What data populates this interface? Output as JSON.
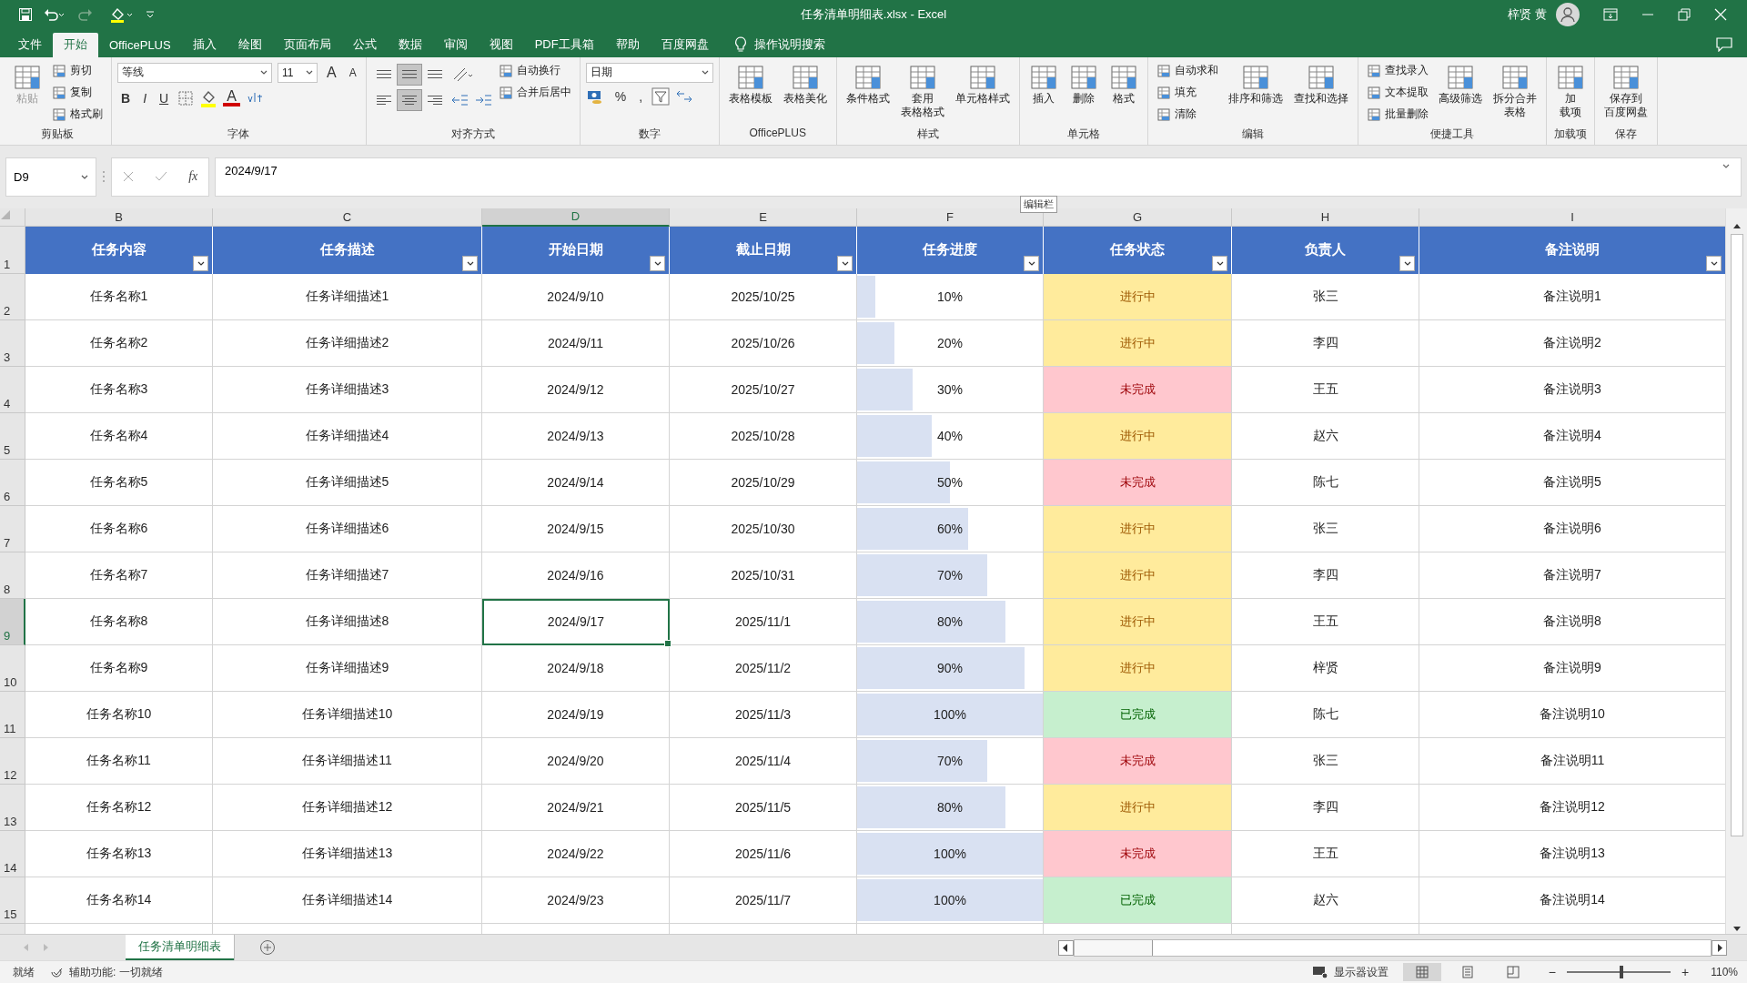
{
  "window": {
    "title": "任务清单明细表.xlsx  -  Excel",
    "user": "梓贤 黄"
  },
  "tabs": [
    {
      "label": "文件",
      "selected": false
    },
    {
      "label": "开始",
      "selected": true
    },
    {
      "label": "OfficePLUS",
      "selected": false
    },
    {
      "label": "插入",
      "selected": false
    },
    {
      "label": "绘图",
      "selected": false
    },
    {
      "label": "页面布局",
      "selected": false
    },
    {
      "label": "公式",
      "selected": false
    },
    {
      "label": "数据",
      "selected": false
    },
    {
      "label": "审阅",
      "selected": false
    },
    {
      "label": "视图",
      "selected": false
    },
    {
      "label": "PDF工具箱",
      "selected": false
    },
    {
      "label": "帮助",
      "selected": false
    },
    {
      "label": "百度网盘",
      "selected": false
    }
  ],
  "tell_me": "操作说明搜索",
  "ribbon": {
    "groups": [
      {
        "kind": "buttons",
        "label": "剪贴板",
        "items": [
          {
            "kind": "large",
            "label": "粘贴",
            "disabled": true
          },
          {
            "kind": "small",
            "label": "剪切",
            "disabled": false
          },
          {
            "kind": "small",
            "label": "复制",
            "disabled": false
          },
          {
            "kind": "small",
            "label": "格式刷",
            "disabled": false
          }
        ]
      },
      {
        "kind": "font",
        "label": "字体",
        "font": "等线",
        "size": "11",
        "size_buttons": [
          "A",
          "A"
        ],
        "styles": [
          "B",
          "I",
          "U"
        ],
        "color_letter": "A"
      },
      {
        "kind": "align",
        "label": "对齐方式",
        "align_buttons": [
          {
            "selected": false
          },
          {
            "selected": true
          },
          {
            "selected": false
          },
          {
            "selected": false
          },
          {
            "selected": true
          },
          {
            "selected": false
          }
        ],
        "items": [
          {
            "kind": "small",
            "label": "自动换行",
            "disabled": false
          },
          {
            "kind": "small",
            "label": "合并后居中",
            "disabled": false
          }
        ]
      },
      {
        "kind": "number",
        "label": "数字",
        "format": "日期",
        "symbols": [
          "%",
          ","
        ]
      },
      {
        "kind": "buttons",
        "label": "OfficePLUS",
        "items": [
          {
            "kind": "large",
            "label": "表格模板",
            "disabled": false
          },
          {
            "kind": "large",
            "label": "表格美化",
            "disabled": false
          }
        ]
      },
      {
        "kind": "buttons",
        "label": "样式",
        "items": [
          {
            "kind": "large",
            "label": "条件格式",
            "disabled": false
          },
          {
            "kind": "large",
            "label": "套用",
            "label_2": "表格格式",
            "disabled": false
          },
          {
            "kind": "large",
            "label": "单元格样式",
            "disabled": false
          }
        ]
      },
      {
        "kind": "buttons",
        "label": "单元格",
        "items": [
          {
            "kind": "large",
            "label": "插入",
            "disabled": false
          },
          {
            "kind": "large",
            "label": "删除",
            "disabled": false
          },
          {
            "kind": "large",
            "label": "格式",
            "disabled": false
          }
        ]
      },
      {
        "kind": "buttons",
        "label": "编辑",
        "items": [
          {
            "kind": "small",
            "label": "自动求和",
            "disabled": false
          },
          {
            "kind": "small",
            "label": "填充",
            "disabled": false
          },
          {
            "kind": "small",
            "label": "清除",
            "disabled": false
          },
          {
            "kind": "large",
            "label": "排序和筛选",
            "disabled": false
          },
          {
            "kind": "large",
            "label": "查找和选择",
            "disabled": false
          }
        ]
      },
      {
        "kind": "buttons",
        "label": "便捷工具",
        "items": [
          {
            "kind": "small",
            "label": "查找录入",
            "disabled": false
          },
          {
            "kind": "small",
            "label": "文本提取",
            "disabled": false
          },
          {
            "kind": "small",
            "label": "批量删除",
            "disabled": false
          },
          {
            "kind": "large",
            "label": "高级筛选",
            "disabled": false
          },
          {
            "kind": "large",
            "label": "拆分合并",
            "label_2": "表格",
            "disabled": false
          }
        ]
      },
      {
        "kind": "buttons",
        "label": "加载项",
        "items": [
          {
            "kind": "large",
            "label": "加",
            "label_2": "载项",
            "disabled": false
          }
        ]
      },
      {
        "kind": "buttons",
        "label": "保存",
        "items": [
          {
            "kind": "large",
            "label": "保存到",
            "label_2": "百度网盘",
            "disabled": false
          }
        ]
      }
    ]
  },
  "formula_bar": {
    "name_box": "D9",
    "fx": "fx",
    "value": "2024/9/17",
    "tooltip": "编辑栏"
  },
  "sheet": {
    "columns": [
      {
        "label": "B",
        "selected": false
      },
      {
        "label": "C",
        "selected": false
      },
      {
        "label": "D",
        "selected": true
      },
      {
        "label": "E",
        "selected": false
      },
      {
        "label": "F",
        "selected": false
      },
      {
        "label": "G",
        "selected": false
      },
      {
        "label": "H",
        "selected": false
      },
      {
        "label": "I",
        "selected": false
      }
    ],
    "header_row_number": "1",
    "headers": [
      "任务内容",
      "任务描述",
      "开始日期",
      "截止日期",
      "任务进度",
      "任务状态",
      "负责人",
      "备注说明"
    ],
    "rows": [
      {
        "number": "2",
        "row_selected": false,
        "name": "任务名称1",
        "desc": "任务详细描述1",
        "start": "2024/9/10",
        "start_selected": false,
        "end": "2025/10/25",
        "progress": "10%",
        "level": 0.1,
        "status": {
          "text": "进行中",
          "kind": "ongoing"
        },
        "owner": "张三",
        "note": "备注说明1"
      },
      {
        "number": "3",
        "row_selected": false,
        "name": "任务名称2",
        "desc": "任务详细描述2",
        "start": "2024/9/11",
        "start_selected": false,
        "end": "2025/10/26",
        "progress": "20%",
        "level": 0.2,
        "status": {
          "text": "进行中",
          "kind": "ongoing"
        },
        "owner": "李四",
        "note": "备注说明2"
      },
      {
        "number": "4",
        "row_selected": false,
        "name": "任务名称3",
        "desc": "任务详细描述3",
        "start": "2024/9/12",
        "start_selected": false,
        "end": "2025/10/27",
        "progress": "30%",
        "level": 0.3,
        "status": {
          "text": "未完成",
          "kind": "incomplete"
        },
        "owner": "王五",
        "note": "备注说明3"
      },
      {
        "number": "5",
        "row_selected": false,
        "name": "任务名称4",
        "desc": "任务详细描述4",
        "start": "2024/9/13",
        "start_selected": false,
        "end": "2025/10/28",
        "progress": "40%",
        "level": 0.4,
        "status": {
          "text": "进行中",
          "kind": "ongoing"
        },
        "owner": "赵六",
        "note": "备注说明4"
      },
      {
        "number": "6",
        "row_selected": false,
        "name": "任务名称5",
        "desc": "任务详细描述5",
        "start": "2024/9/14",
        "start_selected": false,
        "end": "2025/10/29",
        "progress": "50%",
        "level": 0.5,
        "status": {
          "text": "未完成",
          "kind": "incomplete"
        },
        "owner": "陈七",
        "note": "备注说明5"
      },
      {
        "number": "7",
        "row_selected": false,
        "name": "任务名称6",
        "desc": "任务详细描述6",
        "start": "2024/9/15",
        "start_selected": false,
        "end": "2025/10/30",
        "progress": "60%",
        "level": 0.6,
        "status": {
          "text": "进行中",
          "kind": "ongoing"
        },
        "owner": "张三",
        "note": "备注说明6"
      },
      {
        "number": "8",
        "row_selected": false,
        "name": "任务名称7",
        "desc": "任务详细描述7",
        "start": "2024/9/16",
        "start_selected": false,
        "end": "2025/10/31",
        "progress": "70%",
        "level": 0.7,
        "status": {
          "text": "进行中",
          "kind": "ongoing"
        },
        "owner": "李四",
        "note": "备注说明7"
      },
      {
        "number": "9",
        "row_selected": true,
        "name": "任务名称8",
        "desc": "任务详细描述8",
        "start": "2024/9/17",
        "start_selected": true,
        "end": "2025/11/1",
        "progress": "80%",
        "level": 0.8,
        "status": {
          "text": "进行中",
          "kind": "ongoing"
        },
        "owner": "王五",
        "note": "备注说明8"
      },
      {
        "number": "10",
        "row_selected": false,
        "name": "任务名称9",
        "desc": "任务详细描述9",
        "start": "2024/9/18",
        "start_selected": false,
        "end": "2025/11/2",
        "progress": "90%",
        "level": 0.9,
        "status": {
          "text": "进行中",
          "kind": "ongoing"
        },
        "owner": "梓贤",
        "note": "备注说明9"
      },
      {
        "number": "11",
        "row_selected": false,
        "name": "任务名称10",
        "desc": "任务详细描述10",
        "start": "2024/9/19",
        "start_selected": false,
        "end": "2025/11/3",
        "progress": "100%",
        "level": 1,
        "status": {
          "text": "已完成",
          "kind": "done"
        },
        "owner": "陈七",
        "note": "备注说明10"
      },
      {
        "number": "12",
        "row_selected": false,
        "name": "任务名称11",
        "desc": "任务详细描述11",
        "start": "2024/9/20",
        "start_selected": false,
        "end": "2025/11/4",
        "progress": "70%",
        "level": 0.7,
        "status": {
          "text": "未完成",
          "kind": "incomplete"
        },
        "owner": "张三",
        "note": "备注说明11"
      },
      {
        "number": "13",
        "row_selected": false,
        "name": "任务名称12",
        "desc": "任务详细描述12",
        "start": "2024/9/21",
        "start_selected": false,
        "end": "2025/11/5",
        "progress": "80%",
        "level": 0.8,
        "status": {
          "text": "进行中",
          "kind": "ongoing"
        },
        "owner": "李四",
        "note": "备注说明12"
      },
      {
        "number": "14",
        "row_selected": false,
        "name": "任务名称13",
        "desc": "任务详细描述13",
        "start": "2024/9/22",
        "start_selected": false,
        "end": "2025/11/6",
        "progress": "100%",
        "level": 1,
        "status": {
          "text": "未完成",
          "kind": "incomplete"
        },
        "owner": "王五",
        "note": "备注说明13"
      },
      {
        "number": "15",
        "row_selected": false,
        "name": "任务名称14",
        "desc": "任务详细描述14",
        "start": "2024/9/23",
        "start_selected": false,
        "end": "2025/11/7",
        "progress": "100%",
        "level": 1,
        "status": {
          "text": "已完成",
          "kind": "done"
        },
        "owner": "赵六",
        "note": "备注说明14"
      }
    ]
  },
  "sheet_tabs": [
    {
      "label": "任务清单明细表",
      "selected": true
    }
  ],
  "status_bar": {
    "ready": "就绪",
    "accessibility": "辅助功能: 一切就绪",
    "display_settings": "显示器设置",
    "views": [
      {
        "selected": true
      },
      {
        "selected": false
      },
      {
        "selected": false
      }
    ],
    "zoom_minus": "−",
    "zoom_plus": "+",
    "zoom_slider": {
      "level": 0.53
    },
    "zoom": "110%"
  }
}
